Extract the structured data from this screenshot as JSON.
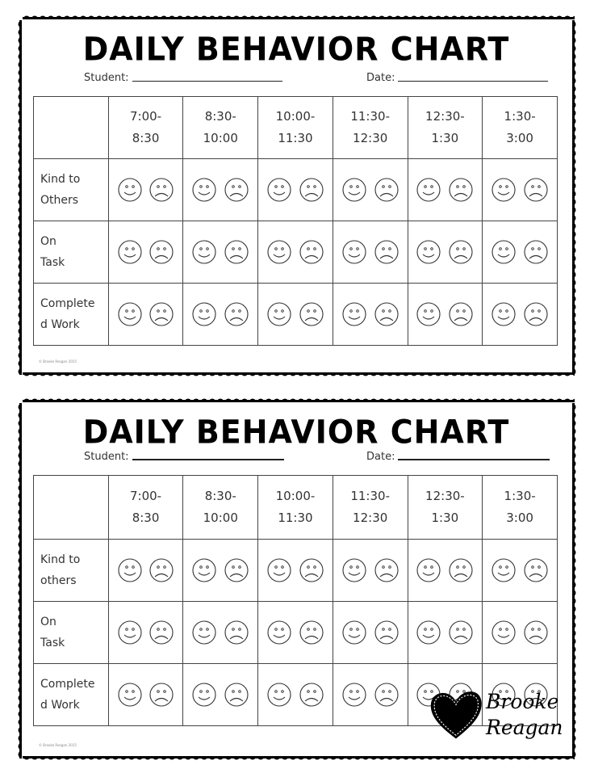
{
  "charts": [
    {
      "title": "DAILY BEHAVIOR CHART",
      "student_label": "Student:",
      "date_label": "Date:",
      "time_slots": [
        [
          "7:00-",
          "8:30"
        ],
        [
          "8:30-",
          "10:00"
        ],
        [
          "10:00-",
          "11:30"
        ],
        [
          "11:30-",
          "12:30"
        ],
        [
          "12:30-",
          "1:30"
        ],
        [
          "1:30-",
          "3:00"
        ]
      ],
      "behaviors": [
        [
          "Kind to",
          "Others"
        ],
        [
          "On",
          "Task"
        ],
        [
          "Complete",
          "d Work"
        ]
      ],
      "face_icons": [
        "smiley-face",
        "frowny-face"
      ],
      "copyright": "© Brooke Reagan 2015"
    },
    {
      "title": "DAILY BEHAVIOR CHART",
      "student_label": "Student:",
      "date_label": "Date:",
      "time_slots": [
        [
          "7:00-",
          "8:30"
        ],
        [
          "8:30-",
          "10:00"
        ],
        [
          "10:00-",
          "11:30"
        ],
        [
          "11:30-",
          "12:30"
        ],
        [
          "12:30-",
          "1:30"
        ],
        [
          "1:30-",
          "3:00"
        ]
      ],
      "behaviors": [
        [
          "Kind to",
          "others"
        ],
        [
          "On",
          "Task"
        ],
        [
          "Complete",
          "d Work"
        ]
      ],
      "face_icons": [
        "smiley-face",
        "frowny-face"
      ],
      "copyright": "© Brooke Reagan 2015"
    }
  ],
  "brand": {
    "line1": "Brooke",
    "line2": "Reagan",
    "icon": "heart-icon"
  }
}
